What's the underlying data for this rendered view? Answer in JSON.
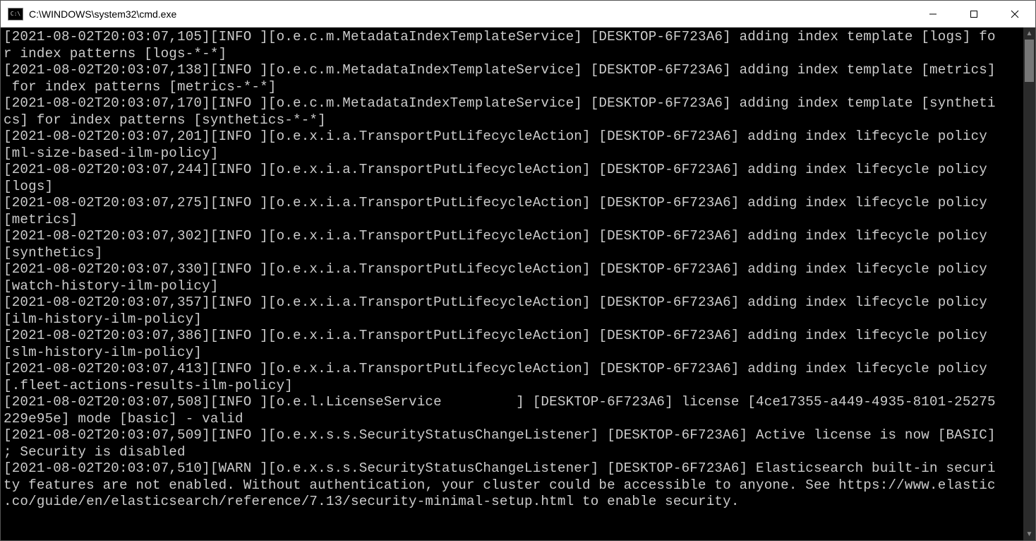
{
  "window": {
    "title": "C:\\WINDOWS\\system32\\cmd.exe"
  },
  "log_entries": [
    {
      "ts": "2021-08-02T20:03:07,105",
      "level": "INFO ",
      "logger": "o.e.c.m.MetadataIndexTemplateService",
      "node": "DESKTOP-6F723A6",
      "msg": "adding index template [logs] for index patterns [logs-*-*]"
    },
    {
      "ts": "2021-08-02T20:03:07,138",
      "level": "INFO ",
      "logger": "o.e.c.m.MetadataIndexTemplateService",
      "node": "DESKTOP-6F723A6",
      "msg": "adding index template [metrics] for index patterns [metrics-*-*]"
    },
    {
      "ts": "2021-08-02T20:03:07,170",
      "level": "INFO ",
      "logger": "o.e.c.m.MetadataIndexTemplateService",
      "node": "DESKTOP-6F723A6",
      "msg": "adding index template [synthetics] for index patterns [synthetics-*-*]"
    },
    {
      "ts": "2021-08-02T20:03:07,201",
      "level": "INFO ",
      "logger": "o.e.x.i.a.TransportPutLifecycleAction",
      "node": "DESKTOP-6F723A6",
      "msg": "adding index lifecycle policy [ml-size-based-ilm-policy]"
    },
    {
      "ts": "2021-08-02T20:03:07,244",
      "level": "INFO ",
      "logger": "o.e.x.i.a.TransportPutLifecycleAction",
      "node": "DESKTOP-6F723A6",
      "msg": "adding index lifecycle policy [logs]"
    },
    {
      "ts": "2021-08-02T20:03:07,275",
      "level": "INFO ",
      "logger": "o.e.x.i.a.TransportPutLifecycleAction",
      "node": "DESKTOP-6F723A6",
      "msg": "adding index lifecycle policy [metrics]"
    },
    {
      "ts": "2021-08-02T20:03:07,302",
      "level": "INFO ",
      "logger": "o.e.x.i.a.TransportPutLifecycleAction",
      "node": "DESKTOP-6F723A6",
      "msg": "adding index lifecycle policy [synthetics]"
    },
    {
      "ts": "2021-08-02T20:03:07,330",
      "level": "INFO ",
      "logger": "o.e.x.i.a.TransportPutLifecycleAction",
      "node": "DESKTOP-6F723A6",
      "msg": "adding index lifecycle policy [watch-history-ilm-policy]"
    },
    {
      "ts": "2021-08-02T20:03:07,357",
      "level": "INFO ",
      "logger": "o.e.x.i.a.TransportPutLifecycleAction",
      "node": "DESKTOP-6F723A6",
      "msg": "adding index lifecycle policy [ilm-history-ilm-policy]"
    },
    {
      "ts": "2021-08-02T20:03:07,386",
      "level": "INFO ",
      "logger": "o.e.x.i.a.TransportPutLifecycleAction",
      "node": "DESKTOP-6F723A6",
      "msg": "adding index lifecycle policy [slm-history-ilm-policy]"
    },
    {
      "ts": "2021-08-02T20:03:07,413",
      "level": "INFO ",
      "logger": "o.e.x.i.a.TransportPutLifecycleAction",
      "node": "DESKTOP-6F723A6",
      "msg": "adding index lifecycle policy [.fleet-actions-results-ilm-policy]"
    },
    {
      "ts": "2021-08-02T20:03:07,508",
      "level": "INFO ",
      "logger": "o.e.l.LicenseService         ",
      "node": "DESKTOP-6F723A6",
      "msg": "license [4ce17355-a449-4935-8101-25275229e95e] mode [basic] - valid"
    },
    {
      "ts": "2021-08-02T20:03:07,509",
      "level": "INFO ",
      "logger": "o.e.x.s.s.SecurityStatusChangeListener",
      "node": "DESKTOP-6F723A6",
      "msg": "Active license is now [BASIC]; Security is disabled"
    },
    {
      "ts": "2021-08-02T20:03:07,510",
      "level": "WARN ",
      "logger": "o.e.x.s.s.SecurityStatusChangeListener",
      "node": "DESKTOP-6F723A6",
      "msg": "Elasticsearch built-in security features are not enabled. Without authentication, your cluster could be accessible to anyone. See https://www.elastic.co/guide/en/elasticsearch/reference/7.13/security-minimal-setup.html to enable security."
    }
  ]
}
